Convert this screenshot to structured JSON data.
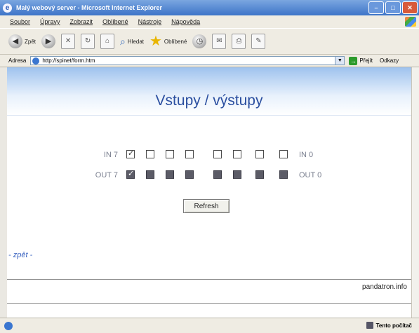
{
  "window": {
    "title": "Malý webový server - Microsoft Internet Explorer",
    "min": "–",
    "max": "□",
    "close": "✕"
  },
  "menu": [
    "Soubor",
    "Úpravy",
    "Zobrazit",
    "Oblíbené",
    "Nástroje",
    "Nápověda"
  ],
  "toolbar": {
    "back": "Zpět",
    "search": "Hledat",
    "favorites": "Oblíbené"
  },
  "address": {
    "label": "Adresa",
    "url": "http://spinet/form.htm",
    "go": "Přejít",
    "links": "Odkazy"
  },
  "page": {
    "title": "Vstupy / výstupy",
    "in_row": {
      "left": "IN 7",
      "right": "IN 0",
      "checked": [
        true,
        false,
        false,
        false,
        false,
        false,
        false,
        false
      ]
    },
    "out_row": {
      "left": "OUT 7",
      "right": "OUT 0",
      "checked": [
        true,
        false,
        false,
        false,
        false,
        false,
        false,
        false
      ]
    },
    "refresh_label": "Refresh",
    "back_link": "- zpět -",
    "footer_brand": "pandatron.info"
  },
  "status": {
    "zone": "Tento počítač"
  }
}
